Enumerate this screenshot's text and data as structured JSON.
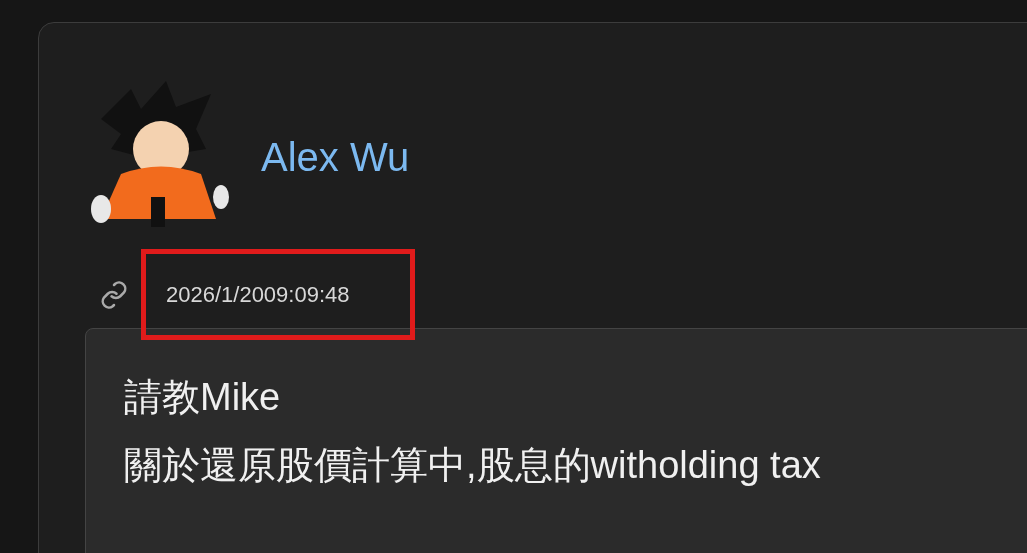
{
  "post": {
    "author": "Alex Wu",
    "timestamp": {
      "text": "2026/1/2009:09:48",
      "highlighted": true
    },
    "body": [
      "請教Mike",
      "關於還原股價計算中,股息的witholding tax"
    ]
  }
}
